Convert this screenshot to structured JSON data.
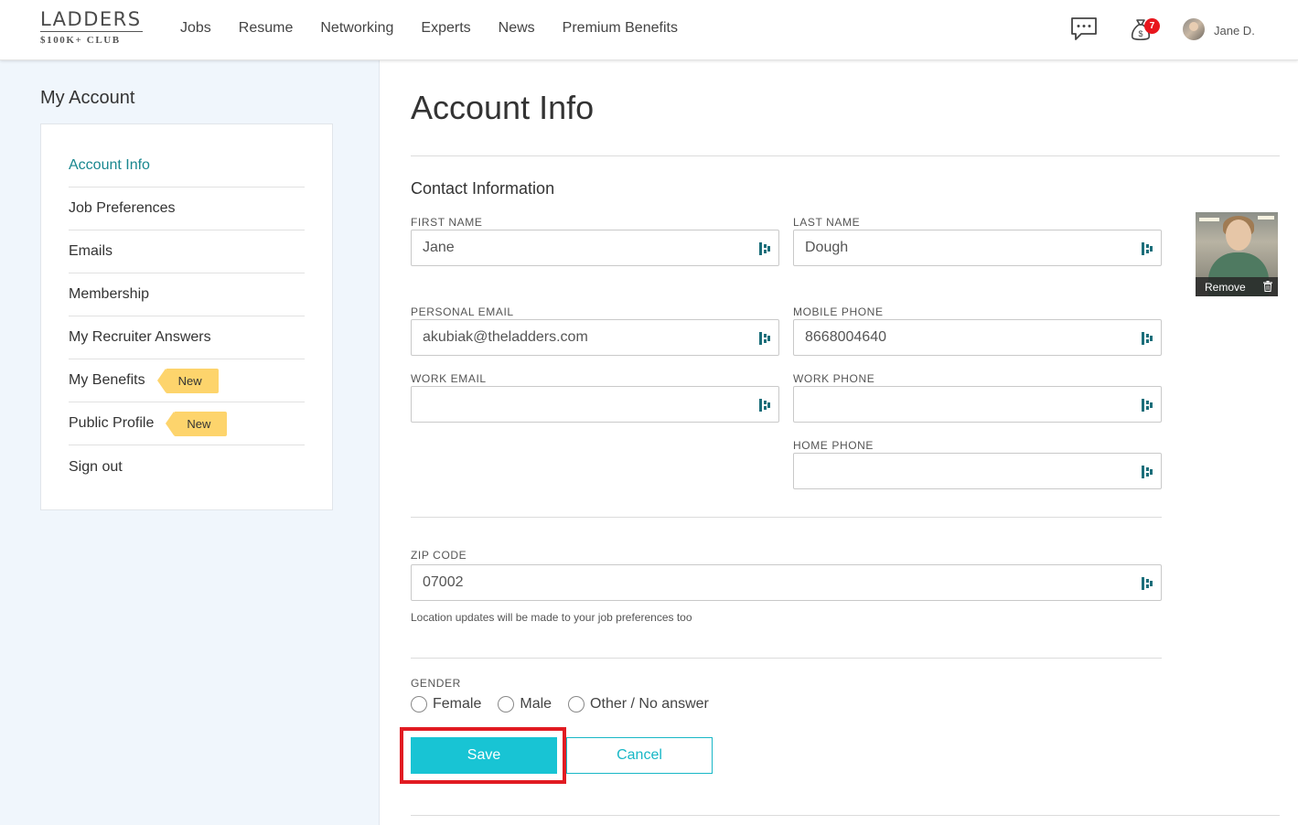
{
  "header": {
    "logo_top": "LADDERS",
    "logo_bottom": "$100K+ CLUB",
    "nav": [
      "Jobs",
      "Resume",
      "Networking",
      "Experts",
      "News",
      "Premium Benefits"
    ],
    "notification_count": "7",
    "user_name": "Jane D."
  },
  "sidebar": {
    "title": "My Account",
    "items": [
      {
        "label": "Account Info"
      },
      {
        "label": "Job Preferences"
      },
      {
        "label": "Emails"
      },
      {
        "label": "Membership"
      },
      {
        "label": "My Recruiter Answers"
      },
      {
        "label": "My Benefits",
        "tag": "New"
      },
      {
        "label": "Public Profile",
        "tag": "New"
      },
      {
        "label": "Sign out"
      }
    ]
  },
  "main": {
    "title": "Account Info",
    "section_title": "Contact Information",
    "fields": {
      "first_name": {
        "label": "FIRST NAME",
        "value": "Jane"
      },
      "last_name": {
        "label": "LAST NAME",
        "value": "Dough"
      },
      "personal_email": {
        "label": "PERSONAL EMAIL",
        "value": "akubiak@theladders.com"
      },
      "mobile_phone": {
        "label": "MOBILE PHONE",
        "value": "8668004640"
      },
      "work_email": {
        "label": "WORK EMAIL",
        "value": ""
      },
      "work_phone": {
        "label": "WORK PHONE",
        "value": ""
      },
      "home_phone": {
        "label": "HOME PHONE",
        "value": ""
      },
      "zip_code": {
        "label": "ZIP CODE",
        "value": "07002"
      }
    },
    "zip_helper": "Location updates will be made to your job preferences too",
    "photo": {
      "remove_label": "Remove"
    },
    "gender": {
      "label": "GENDER",
      "options": [
        "Female",
        "Male",
        "Other / No answer"
      ]
    },
    "save_label": "Save",
    "cancel_label": "Cancel"
  },
  "colors": {
    "accent": "#18c4d4",
    "active_nav": "#19878f",
    "new_tag": "#fdd46c",
    "badge": "#e8161d",
    "highlight": "#e11b22",
    "sidebar_bg": "#f0f6fc"
  }
}
